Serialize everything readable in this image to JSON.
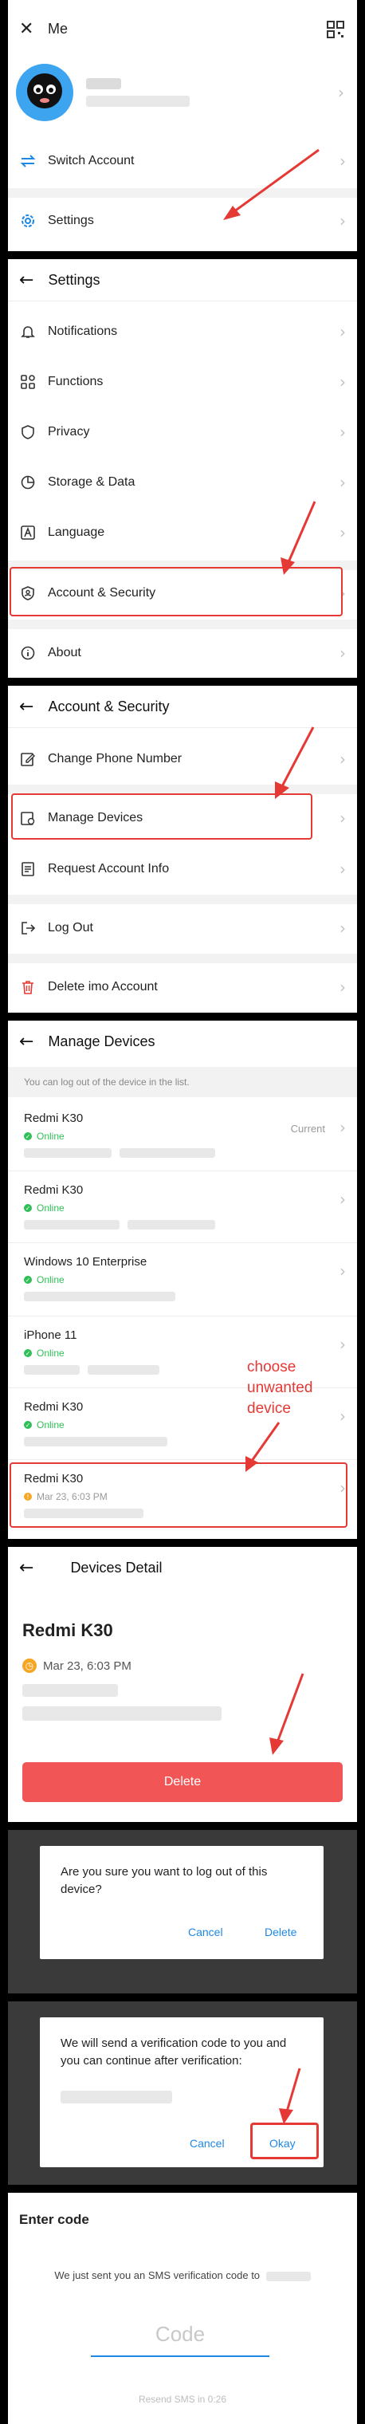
{
  "me": {
    "title": "Me",
    "switch_account": "Switch Account",
    "settings": "Settings"
  },
  "settings": {
    "title": "Settings",
    "items": [
      "Notifications",
      "Functions",
      "Privacy",
      "Storage & Data",
      "Language",
      "Account & Security",
      "About"
    ]
  },
  "account_security": {
    "title": "Account & Security",
    "items": [
      "Change Phone Number",
      "Manage Devices",
      "Request Account Info",
      "Log Out",
      "Delete imo Account"
    ]
  },
  "manage_devices": {
    "title": "Manage Devices",
    "notice": "You can log out of the device in the list.",
    "current_label": "Current",
    "online_label": "Online",
    "devices": [
      {
        "name": "Redmi K30",
        "status": "Online"
      },
      {
        "name": "Redmi K30",
        "status": "Online"
      },
      {
        "name": "Windows 10 Enterprise",
        "status": "Online"
      },
      {
        "name": "iPhone 11",
        "status": "Online"
      },
      {
        "name": "Redmi K30",
        "status": "Online"
      },
      {
        "name": "Redmi K30",
        "status": "Mar 23, 6:03 PM"
      }
    ],
    "annotation": "choose\nunwanted\ndevice"
  },
  "device_detail": {
    "title": "Devices Detail",
    "device_name": "Redmi K30",
    "last_seen": "Mar 23, 6:03 PM",
    "delete_label": "Delete"
  },
  "confirm_dialog": {
    "message": "Are you sure you want to log out of this device?",
    "cancel": "Cancel",
    "delete": "Delete"
  },
  "verify_dialog": {
    "message": "We will send a verification code to you and you can continue after verification:",
    "cancel": "Cancel",
    "okay": "Okay"
  },
  "enter_code": {
    "title": "Enter code",
    "message": "We just sent you an SMS verification code to",
    "placeholder": "Code",
    "resend": "Resend SMS in 0:26"
  },
  "colors": {
    "accent": "#1e88e5",
    "online": "#2fbf56",
    "delete": "#f25555",
    "annotation": "#e53935"
  }
}
